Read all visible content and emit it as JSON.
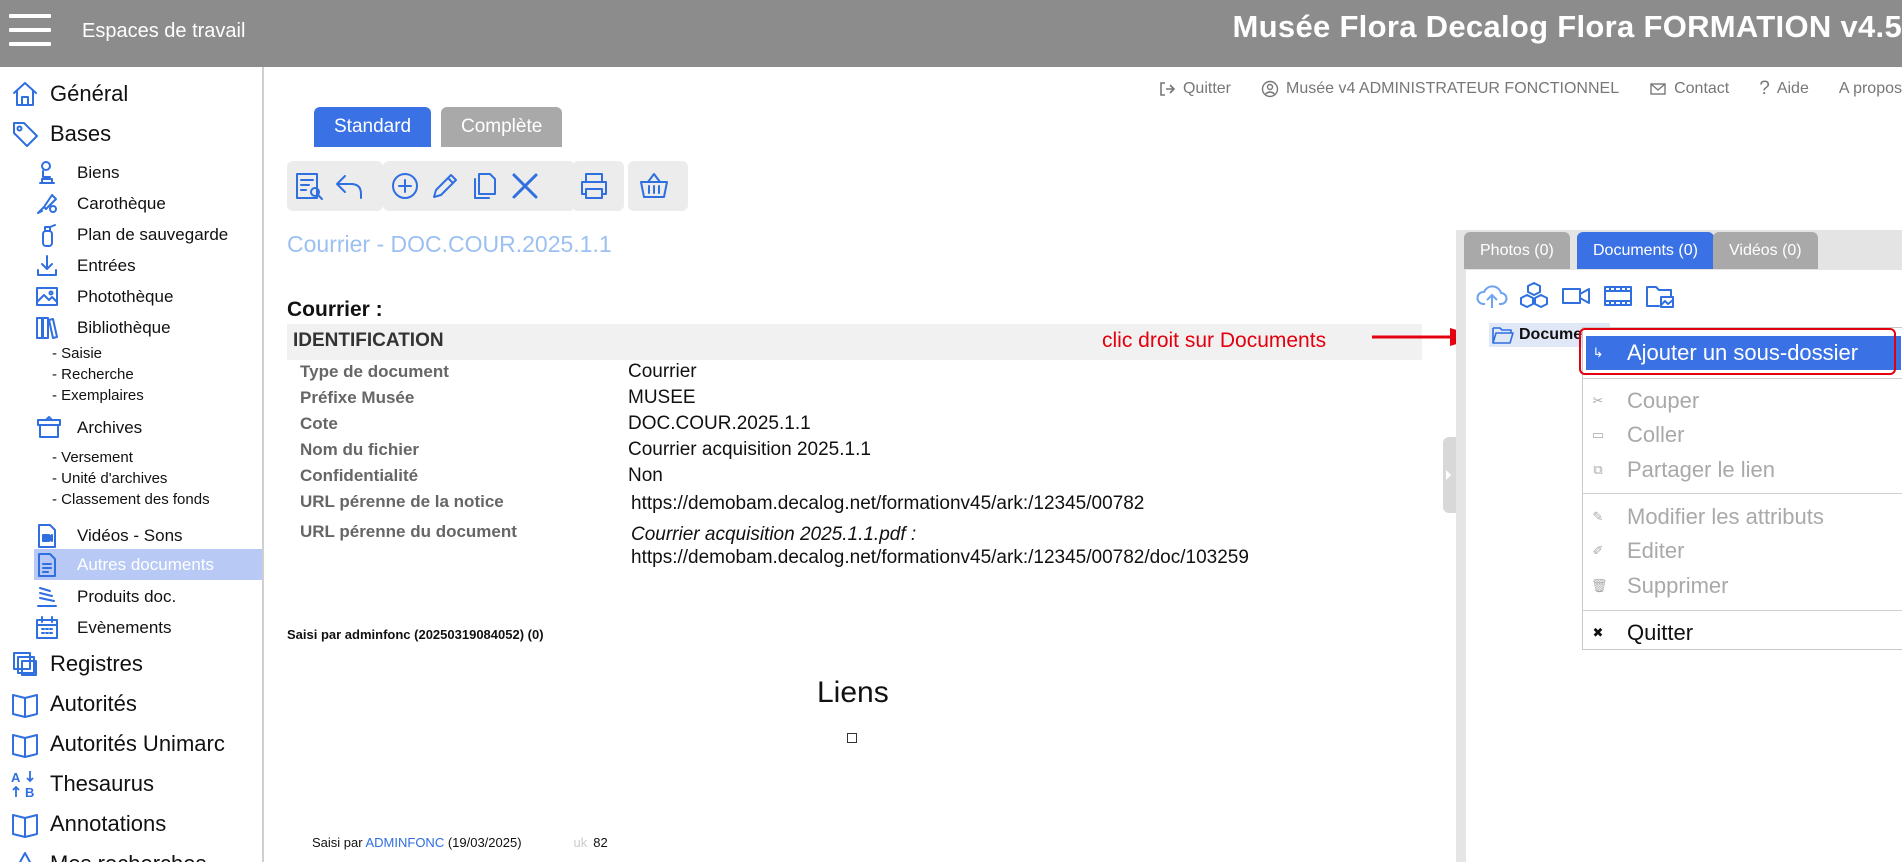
{
  "header": {
    "menu_icon": "hamburger-icon",
    "workspaces_label": "Espaces de travail",
    "app_title": "Musée Flora Decalog Flora FORMATION v4.5"
  },
  "sidebar": {
    "top": [
      {
        "label": "Général",
        "icon": "home-icon"
      },
      {
        "label": "Bases",
        "icon": "tag-icon"
      }
    ],
    "bases_items": [
      {
        "label": "Biens",
        "icon": "statue-icon"
      },
      {
        "label": "Carothèque",
        "icon": "map-pen-icon"
      },
      {
        "label": "Plan de sauvegarde",
        "icon": "extinguisher-icon"
      },
      {
        "label": "Entrées",
        "icon": "download-tray-icon"
      },
      {
        "label": "Photothèque",
        "icon": "image-icon"
      },
      {
        "label": "Bibliothèque",
        "icon": "books-icon"
      }
    ],
    "bibliotheque_leaves": [
      "- Saisie",
      "- Recherche",
      "- Exemplaires"
    ],
    "archives": {
      "label": "Archives",
      "icon": "archive-box-icon"
    },
    "archives_leaves": [
      "- Versement",
      "- Unité d'archives",
      "- Classement des fonds"
    ],
    "more_items": [
      {
        "label": "Vidéos - Sons",
        "icon": "video-file-icon"
      },
      {
        "label": "Autres documents",
        "icon": "document-icon",
        "active": true
      },
      {
        "label": "Produits doc.",
        "icon": "stack-icon"
      },
      {
        "label": "Evènements",
        "icon": "calendar-icon"
      }
    ],
    "bottom": [
      {
        "label": "Registres",
        "icon": "registers-icon"
      },
      {
        "label": "Autorités",
        "icon": "open-book-icon"
      },
      {
        "label": "Autorités Unimarc",
        "icon": "open-book-icon"
      },
      {
        "label": "Thesaurus",
        "icon": "az-sort-icon"
      },
      {
        "label": "Annotations",
        "icon": "open-book-icon"
      },
      {
        "label": "Mes recherches",
        "icon": "triangle-icon"
      }
    ]
  },
  "toplinks": {
    "quit": "Quitter",
    "user": "Musée v4 ADMINISTRATEUR FONCTIONNEL",
    "contact": "Contact",
    "help": "Aide",
    "about": "A propos"
  },
  "view_tabs": {
    "standard": "Standard",
    "complete": "Complète"
  },
  "toolbar": [
    "list-search-icon",
    "undo-icon",
    "add-circle-icon",
    "pencil-icon",
    "copy-icon",
    "close-x-icon",
    "printer-icon",
    "basket-icon"
  ],
  "record": {
    "title": "Courrier - DOC.COUR.2025.1.1",
    "section_heading": "Courrier :",
    "block_label": "IDENTIFICATION",
    "fields": [
      {
        "label": "Type de document",
        "value": "Courrier"
      },
      {
        "label": "Préfixe Musée",
        "value": "MUSEE"
      },
      {
        "label": "Cote",
        "value": "DOC.COUR.2025.1.1"
      },
      {
        "label": "Nom du fichier",
        "value": "Courrier acquisition 2025.1.1"
      },
      {
        "label": "Confidentialité",
        "value": "Non"
      },
      {
        "label": "URL pérenne de la notice",
        "value": "https://demobam.decalog.net/formationv45/ark:/12345/00782"
      },
      {
        "label": "URL pérenne du document",
        "value_italic": "Courrier acquisition 2025.1.1.pdf :",
        "value": "https://demobam.decalog.net/formationv45/ark:/12345/00782/doc/103259"
      }
    ],
    "saisi_header": "Saisi par adminfonc (20250319084052) (0)",
    "liens_title": "Liens",
    "footer": {
      "prefix": "Saisi par ",
      "user": "ADMINFONC",
      "date": " (19/03/2025)",
      "uk_label": "uk",
      "uk_value": "82"
    }
  },
  "annotation": {
    "text": "clic droit sur Documents",
    "color": "#e3000f"
  },
  "media_panel": {
    "tabs": [
      "Photos (0)",
      "Documents (0)",
      "Vidéos (0)"
    ],
    "active_tab": "Documents (0)",
    "icons": [
      "cloud-upload-icon",
      "cubes-icon",
      "video-camera-icon",
      "film-strip-icon",
      "folder-image-icon"
    ],
    "folder_label": "Documents"
  },
  "context_menu": {
    "items": [
      {
        "label": "Ajouter un sous-dossier",
        "icon": "↳",
        "state": "highlighted"
      },
      {
        "label": "Couper",
        "icon": "✂",
        "state": "disabled"
      },
      {
        "label": "Coller",
        "icon": "▭",
        "state": "disabled"
      },
      {
        "label": "Partager le lien",
        "icon": "⧉",
        "state": "disabled"
      },
      {
        "label": "Modifier les attributs",
        "icon": "✎",
        "state": "disabled"
      },
      {
        "label": "Editer",
        "icon": "✐",
        "state": "disabled"
      },
      {
        "label": "Supprimer",
        "icon": "🗑",
        "state": "disabled"
      },
      {
        "label": "Quitter",
        "icon": "✖",
        "state": "enabled"
      }
    ]
  },
  "colors": {
    "accent": "#3a72e6",
    "header_bg": "#8c8c8c",
    "title_blue": "#9cc0f2",
    "active_nav": "#b9c9f5"
  }
}
